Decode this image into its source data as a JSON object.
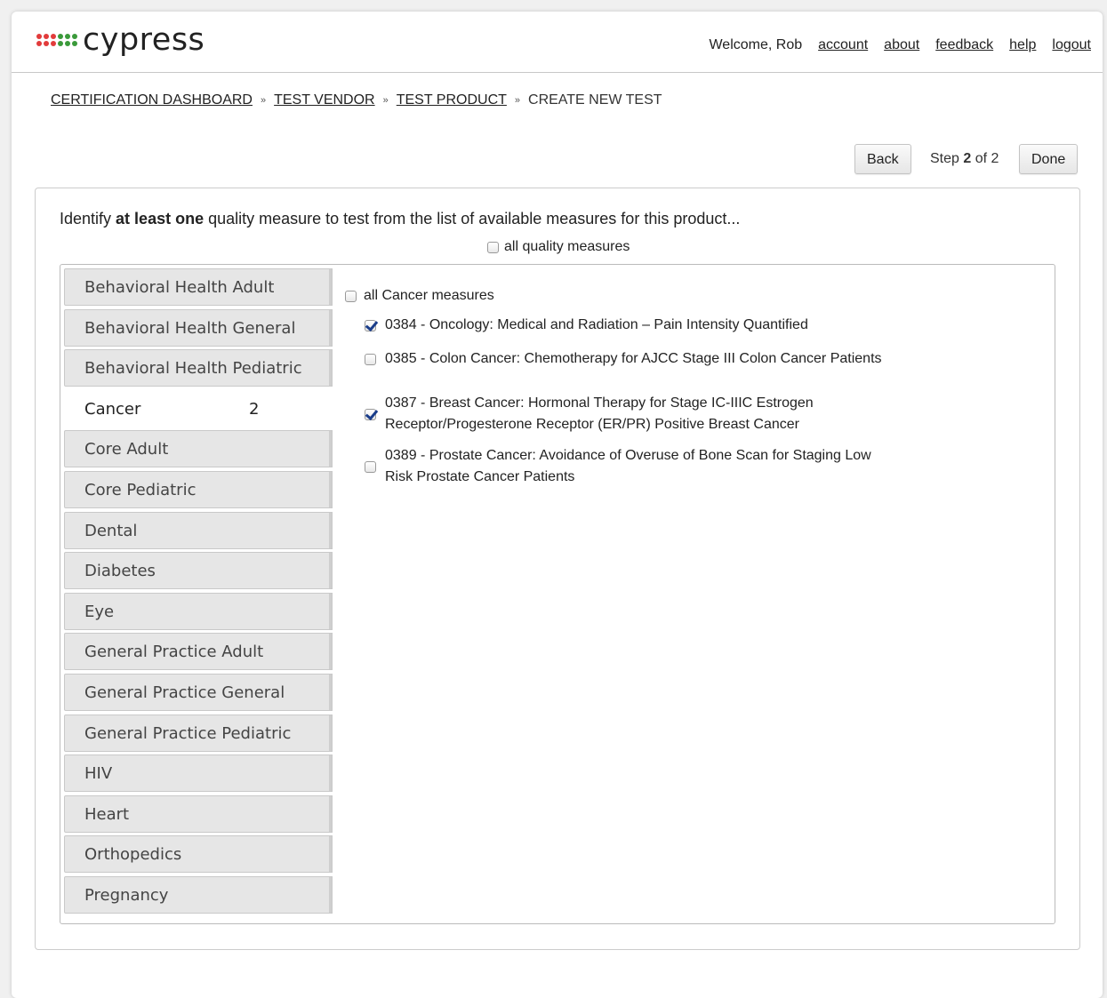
{
  "header": {
    "logo_text": "cypress",
    "logo_dot_colors": [
      "#e23b3b",
      "#e23b3b",
      "#e23b3b",
      "#3a9a3a",
      "#3a9a3a",
      "#3a9a3a",
      "#e23b3b",
      "#e23b3b",
      "#e23b3b",
      "#3a9a3a",
      "#3a9a3a",
      "#3a9a3a"
    ],
    "welcome": "Welcome, Rob",
    "links": [
      "account",
      "about",
      "feedback",
      "help",
      "logout"
    ]
  },
  "breadcrumb": {
    "items": [
      "CERTIFICATION DASHBOARD",
      "TEST VENDOR",
      "TEST PRODUCT"
    ],
    "current": "CREATE NEW TEST",
    "separator": "»"
  },
  "stepper": {
    "back_label": "Back",
    "step_prefix": "Step",
    "step_current": "2",
    "step_suffix": "of 2",
    "done_label": "Done"
  },
  "form": {
    "instruction_pre": "Identify ",
    "instruction_bold": "at least one",
    "instruction_post": " quality measure to test from the list of available measures for this product...",
    "all_quality_label": "all quality measures",
    "all_category_label": "all Cancer measures"
  },
  "categories": [
    {
      "label": "Behavioral Health Adult",
      "count": ""
    },
    {
      "label": "Behavioral Health General",
      "count": ""
    },
    {
      "label": "Behavioral Health Pediatric",
      "count": ""
    },
    {
      "label": "Cancer",
      "count": "2",
      "active": true
    },
    {
      "label": "Core Adult",
      "count": ""
    },
    {
      "label": "Core Pediatric",
      "count": ""
    },
    {
      "label": "Dental",
      "count": ""
    },
    {
      "label": "Diabetes",
      "count": ""
    },
    {
      "label": "Eye",
      "count": ""
    },
    {
      "label": "General Practice Adult",
      "count": ""
    },
    {
      "label": "General Practice General",
      "count": ""
    },
    {
      "label": "General Practice Pediatric",
      "count": ""
    },
    {
      "label": "HIV",
      "count": ""
    },
    {
      "label": "Heart",
      "count": ""
    },
    {
      "label": "Orthopedics",
      "count": ""
    },
    {
      "label": "Pregnancy",
      "count": ""
    }
  ],
  "measures": [
    {
      "line1": "0384 - Oncology: Medical and Radiation – Pain Intensity Quantified",
      "line2": "",
      "checked": true
    },
    {
      "line1": "0385 - Colon Cancer: Chemotherapy for AJCC Stage III Colon Cancer Patients",
      "line2": "",
      "checked": false
    },
    {
      "line1": "0387 - Breast Cancer: Hormonal Therapy for Stage IC-IIIC Estrogen",
      "line2": "Receptor/Progesterone Receptor (ER/PR) Positive Breast Cancer",
      "checked": true
    },
    {
      "line1": "0389 - Prostate Cancer: Avoidance of Overuse of Bone Scan for Staging Low",
      "line2": "Risk Prostate Cancer Patients",
      "checked": false
    }
  ]
}
